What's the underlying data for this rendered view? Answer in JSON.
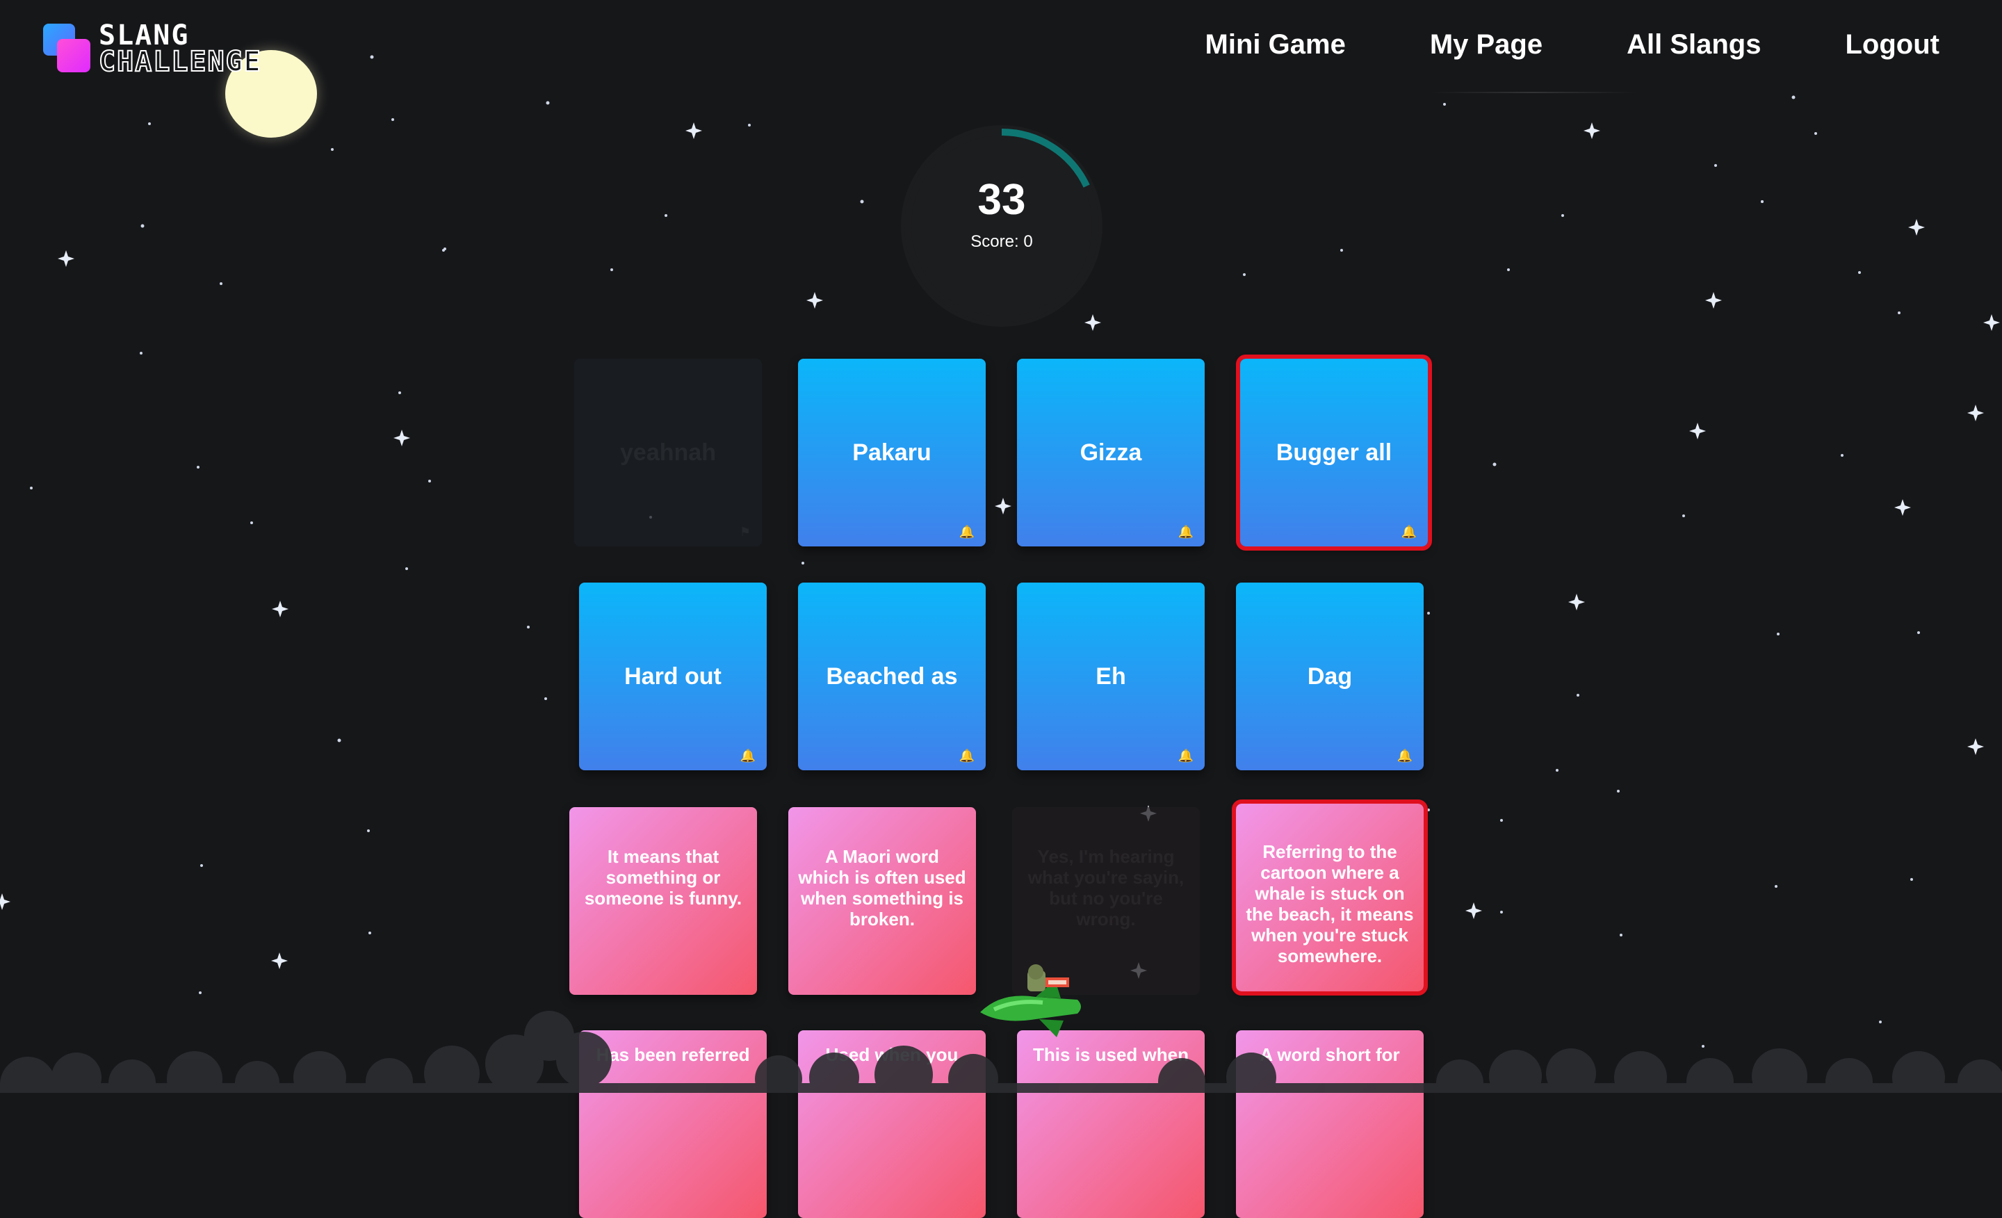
{
  "app": {
    "logo_line1": "SLANG",
    "logo_line2": "CHALLENGE"
  },
  "nav": {
    "items": [
      {
        "label": "Mini Game"
      },
      {
        "label": "My Page"
      },
      {
        "label": "All Slangs"
      },
      {
        "label": "Logout"
      }
    ]
  },
  "timer": {
    "seconds": "33",
    "score_label": "Score: 0",
    "progress_fraction": 0.18,
    "ring_color": "#0e7773"
  },
  "cards": {
    "row1": [
      {
        "text": "yeahnah",
        "state": "matched"
      },
      {
        "text": "Pakaru",
        "state": "normal"
      },
      {
        "text": "Gizza",
        "state": "normal"
      },
      {
        "text": "Bugger all",
        "state": "selected"
      }
    ],
    "row2": [
      {
        "text": "Hard out"
      },
      {
        "text": "Beached as"
      },
      {
        "text": "Eh"
      },
      {
        "text": "Dag"
      }
    ],
    "row3": [
      {
        "text": "It means that something or someone is funny."
      },
      {
        "text": "A Maori word which is often used when something is broken."
      },
      {
        "text": "Yes, I'm hearing what you're sayin, but no you're wrong.",
        "state": "matched"
      },
      {
        "text": "Referring to the cartoon where a whale is stuck on the beach, it means when you're stuck somewhere.",
        "state": "selected"
      }
    ],
    "row4": [
      {
        "text": "Has been referred"
      },
      {
        "text": "Used when you"
      },
      {
        "text": "This is used when"
      },
      {
        "text": "A word short for"
      }
    ]
  },
  "colors": {
    "background": "#161719",
    "term_card_top": "#0bb6f9",
    "term_card_bottom": "#4180ec",
    "def_card_start": "#f196ea",
    "def_card_end": "#f5576c",
    "selected_outline": "#e0101e",
    "moon": "#fbf8c9"
  },
  "icons": {
    "card_badge": "bell-icon",
    "decor": "rocket-icon"
  }
}
